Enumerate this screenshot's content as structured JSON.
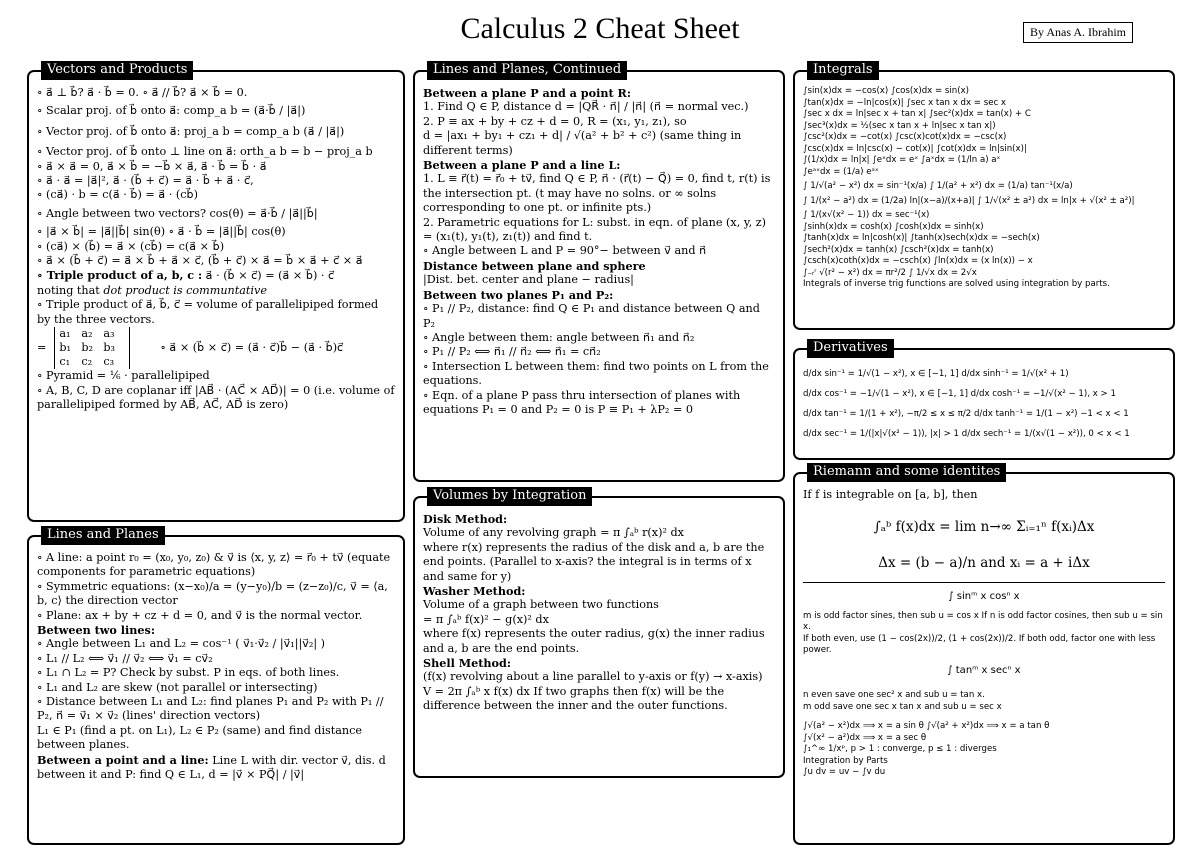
{
  "title": "Calculus 2 Cheat Sheet",
  "author": "By Anas A. Ibrahim",
  "sections": {
    "vectors": {
      "header": "Vectors and Products",
      "lines": [
        "∘ a⃗ ⊥ b⃗? a⃗ · b⃗ = 0.          ∘ a⃗ // b⃗? a⃗ × b⃗ = 0.",
        "∘ Scalar proj. of b⃗ onto a⃗: comp_a b = (a⃗·b⃗ / |a⃗|)",
        "∘ Vector proj. of b⃗ onto a⃗: proj_a b = comp_a b (a⃗ / |a⃗|)",
        "∘ Vector proj. of b⃗ onto ⊥ line on a⃗: orth_a b = b − proj_a b",
        "∘ a⃗ × a⃗ = 0,      a⃗ × b⃗ = −b⃗ × a⃗,      a⃗ · b⃗ = b⃗ · a⃗",
        "∘ a⃗ · a⃗ = |a⃗|²,      a⃗ · (b⃗ + c⃗) = a⃗ · b⃗ + a⃗ · c⃗,",
        "∘ (ca⃗) · b = c(a⃗ · b⃗) = a⃗ · (cb⃗)",
        "∘ Angle between two vectors? cos(θ) = a⃗·b⃗ / |a⃗||b⃗|",
        "∘ |a⃗ × b⃗| = |a⃗||b⃗| sin(θ)      ∘ a⃗ · b⃗ = |a⃗||b⃗| cos(θ)",
        "∘ (ca⃗) × (b⃗) = a⃗ × (cb⃗) = c(a⃗ × b⃗)",
        "∘ a⃗ × (b⃗ + c⃗) = a⃗ × b⃗ + a⃗ × c⃗,    (b⃗ + c⃗) × a⃗ = b⃗ × a⃗ + c⃗ × a⃗"
      ],
      "triple_bold": "∘ Triple product of a, b, c :",
      "triple_rest": " a⃗ · (b⃗ × c⃗) = (a⃗ × b⃗) · c⃗",
      "triple_note_prefix": "noting that ",
      "triple_note_italic": "dot product is communtative",
      "volume_line": "∘ Triple product of a⃗, b⃗, c⃗ = volume of parallelipiped formed by the three vectors.",
      "matrix": [
        [
          "a₁",
          "a₂",
          "a₃"
        ],
        [
          "b₁",
          "b₂",
          "b₃"
        ],
        [
          "c₁",
          "c₂",
          "c₃"
        ]
      ],
      "matrix_prefix": "=",
      "bac_cab": "∘ a⃗ × (b⃗ × c⃗) = (a⃗ · c⃗)b⃗ − (a⃗ · b⃗)c⃗",
      "pyramid": "∘ Pyramid = ⅙ · parallelipiped",
      "coplanar": "∘ A, B, C, D are coplanar iff |AB⃗ · (AC⃗ × AD⃗)| = 0 (i.e. volume of parallelipiped formed by AB⃗, AC⃗, AD⃗ is zero)"
    },
    "lines_planes": {
      "header": "Lines and Planes",
      "lines_a": [
        "∘ A line: a point r₀ = (x₀, y₀, z₀) & v⃗ is ⟨x, y, z⟩ = r⃗₀ + tv⃗ (equate components for parametric equations)",
        "∘ Symmetric equations: (x−x₀)/a = (y−y₀)/b = (z−z₀)/c, v⃗ = ⟨a, b, c⟩ the direction vector",
        "∘ Plane: ax + by + cz + d = 0, and v⃗ is the normal vector."
      ],
      "sub_two_lines": "Between two lines:",
      "lines_b": [
        "∘ Angle between L₁ and L₂ = cos⁻¹ ( v⃗₁·v⃗₂ / |v⃗₁||v⃗₂| )",
        "∘ L₁ // L₂ ⟺ v⃗₁ // v⃗₂ ⟺ v⃗₁ = cv⃗₂",
        "∘ L₁ ∩ L₂ = P? Check by subst. P in eqs. of both lines.",
        "∘ L₁ and L₂ are skew (not parallel or intersecting)",
        "∘ Distance between L₁ and L₂: find planes P₁ and P₂ with P₁ // P₂, n⃗ = v⃗₁ × v⃗₂ (lines' direction vectors)",
        "L₁ ∈ P₁ (find a pt. on L₁), L₂ ∈ P₂ (same) and find distance between planes."
      ],
      "sub_point_line": "Between a point and a line:",
      "point_line_rest": " Line L with dir. vector v⃗, dis. d between it and P: find Q ∈ L₁, d = |v⃗ × PQ⃗| / |v⃗|"
    },
    "lines_planes_cont": {
      "header": "Lines and Planes, Continued",
      "sub_plane_point": "Between a plane P and a point R:",
      "plane_point": [
        "1. Find Q ∈ P, distance d = |QR⃗ · n⃗| / |n⃗| (n⃗ = normal vec.)",
        "2. P ≡ ax + by + cz + d = 0, R = (x₁, y₁, z₁), so",
        "d = |ax₁ + by₁ + cz₁ + d| / √(a² + b² + c²) (same thing in different terms)"
      ],
      "sub_plane_line": "Between a plane P and a line L:",
      "plane_line": [
        "1. L ≡ r⃗(t) = r⃗₀ + tv⃗, find Q ∈ P, n⃗ · (r⃗(t) − Q⃗) = 0, find t, r(t) is the intersection pt. (t may have no solns. or ∞ solns corresponding to one pt. or infinite pts.)",
        "2. Parametric equations for L: subst. in eqn. of plane (x, y, z) = (x₁(t), y₁(t), z₁(t)) and find t.",
        "∘ Angle between L and P = 90°− between v⃗ and n⃗"
      ],
      "sub_sphere": "Distance between plane and sphere",
      "sphere": "|Dist. bet. center and plane − radius|",
      "sub_two_planes": "Between two planes P₁ and P₂:",
      "two_planes": [
        "∘ P₁ // P₂, distance: find Q ∈ P₁ and distance between Q and P₂",
        "∘ Angle between them: angle between n⃗₁ and n⃗₂",
        "∘ P₁ // P₂ ⟺ n⃗₁ // n⃗₂ ⟺ n⃗₁ = cn⃗₂",
        "∘ Intersection L between them: find two points on L from the equations.",
        "∘ Eqn. of a plane P pass thru intersection of planes with equations P₁ = 0 and P₂ = 0 is P ≡ P₁ + λP₂ = 0"
      ]
    },
    "volumes": {
      "header": "Volumes by Integration",
      "disk_title": "Disk Method:",
      "disk": [
        "Volume of any revolving graph = π ∫ₐᵇ r(x)² dx",
        "where r(x) represents the radius of the disk and a, b are the end points. (Parallel to x-axis? the integral is in terms of x and same for y)"
      ],
      "washer_title": "Washer Method:",
      "washer": [
        "Volume of a graph between two functions",
        "= π ∫ₐᵇ f(x)² − g(x)² dx",
        "where f(x) represents the outer radius, g(x) the inner radius and a, b are the end points."
      ],
      "shell_title": "Shell Method:",
      "shell": [
        "(f(x) revolving about a line parallel to y-axis or f(y) → x-axis)",
        "V = 2π ∫ₐᵇ x f(x) dx If two graphs then f(x) will be the difference between the inner and the outer functions."
      ]
    },
    "integrals": {
      "header": "Integrals",
      "lines": [
        "∫sin(x)dx = −cos(x)                  ∫cos(x)dx = sin(x)",
        "∫tan(x)dx = −ln|cos(x)|              ∫sec x tan x dx = sec x",
        "∫sec x dx = ln|sec x + tan x|         ∫sec²(x)dx = tan(x) + C",
        "∫sec³(x)dx = ½(sec x tan x + ln|sec x tan x|)",
        "∫csc²(x)dx = −cot(x)          ∫csc(x)cot(x)dx = −csc(x)",
        "∫csc(x)dx = ln|csc(x) − cot(x)|       ∫cot(x)dx = ln|sin(x)|",
        "∫(1/x)dx = ln|x|      ∫eˣdx = eˣ      ∫aˣdx = (1/ln a) aˣ",
        "∫eᵃˣdx = (1/a) eᵃˣ",
        "∫ 1/√(a² − x²) dx = sin⁻¹(x/a)        ∫ 1/(a² + x²) dx = (1/a) tan⁻¹(x/a)",
        "∫ 1/(x² − a²) dx = (1/2a) ln|(x−a)/(x+a)|      ∫ 1/√(x² ± a²) dx = ln|x + √(x² ± a²)|",
        "∫ 1/(x√(x² − 1)) dx = sec⁻¹(x)",
        "∫sinh(x)dx = cosh(x)              ∫cosh(x)dx = sinh(x)",
        "∫tanh(x)dx = ln|cosh(x)|           ∫tanh(x)sech(x)dx = −sech(x)",
        "∫sech²(x)dx = tanh(x)         ∫csch²(x)dx = tanh(x)",
        "∫csch(x)coth(x)dx = −csch(x)        ∫ln(x)dx = (x ln(x)) − x",
        "∫₋ᵣʳ √(r² − x²) dx = πr²/2        ∫ 1/√x dx = 2√x",
        "Integrals of inverse trig functions are solved using integration by parts."
      ]
    },
    "derivatives": {
      "header": "Derivatives",
      "lines": [
        "d/dx sin⁻¹ = 1/√(1 − x²), x ∈ [−1, 1]        d/dx sinh⁻¹ = 1/√(x² + 1)",
        "d/dx cos⁻¹ = −1/√(1 − x²), x ∈ [−1, 1]      d/dx cosh⁻¹ = −1/√(x² − 1), x > 1",
        "d/dx tan⁻¹ = 1/(1 + x²), −π/2 ≤ x ≤ π/2      d/dx tanh⁻¹ = 1/(1 − x²) −1 < x < 1",
        "d/dx sec⁻¹ = 1/(|x|√(x² − 1)), |x| > 1      d/dx sech⁻¹ = 1/(x√(1 − x²)), 0 < x < 1"
      ]
    },
    "riemann": {
      "header": "Riemann and some identites",
      "intro": "If f is integrable on [a, b], then",
      "formula1": "∫ₐᵇ f(x)dx = lim n→∞ Σᵢ₌₁ⁿ f(xᵢ)Δx",
      "formula2": "Δx = (b − a)/n  and  xᵢ = a + iΔx",
      "sincos_title": "∫ sinᵐ x cosⁿ x",
      "sincos": [
        "m is odd factor sines, then sub u = cos x If n is odd factor cosines, then sub u = sin x.",
        "If both even, use (1 − cos(2x))/2, (1 + cos(2x))/2. If both odd, factor one with less power."
      ],
      "tansec_title": "∫ tanᵐ x secⁿ x",
      "tansec": [
        "n even save one sec² x and sub u = tan x.",
        "m odd save one sec x tan x and sub u = sec x"
      ],
      "misc": [
        "∫√(a² − x²)dx ⟹ x = a sin θ    ∫√(a² + x²)dx ⟹ x = a tan θ",
        "∫√(x² − a²)dx ⟹ x = a sec θ",
        "∫₁^∞ 1/xᵖ, p > 1 : converge, p ≤ 1 : diverges",
        "Integration by Parts",
        "∫u dv = uv − ∫v du"
      ]
    }
  }
}
